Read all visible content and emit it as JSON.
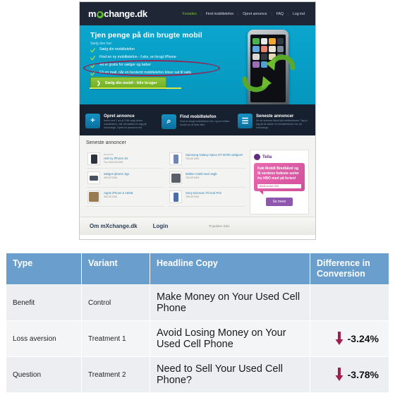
{
  "screenshot": {
    "site": {
      "logo_prefix": "m",
      "logo_suffix": "change.dk",
      "nav": [
        {
          "label": "Forsiden",
          "active": true
        },
        {
          "label": "Find mobiltelefon",
          "active": false
        },
        {
          "label": "Opret annonce",
          "active": false
        },
        {
          "label": "FAQ",
          "active": false
        },
        {
          "label": "Log ind",
          "active": false
        }
      ],
      "hero": {
        "title": "Tjen penge på din brugte mobil",
        "subtitle": "Sælg den her:",
        "bullets": [
          "Sælg din mobiltelefon",
          "Find en ny mobiltelefon - f.eks. en brugt iPhone",
          "Alt er gratis for sælger og køber",
          "Få en mail, når en bestemt mobiltelefon bliver sat til salg."
        ],
        "cta_label": "Sælg din mobil - bliv bruger",
        "cta_arrow": "❯"
      },
      "features": [
        {
          "icon": "plus-icon",
          "glyph": "+",
          "title": "Opret annonce",
          "desc": "Intere end 2 ud af 3 får solgt deres mobiltelefon, når det sættes til salg på mXchange. Opret en annonce her."
        },
        {
          "icon": "search-icon",
          "glyph": "⌕",
          "title": "Find mobiltelefon",
          "desc": "Find en brugt mobiltelefon her, og se hvilken model du vil lede efter."
        },
        {
          "icon": "list-icon",
          "glyph": "☰",
          "title": "Seneste annoncer",
          "desc": "Se de seneste tilbud på mobiltelefoner. Tag et kig på de sidste 10 mobiltelefoner her på mXchange."
        }
      ],
      "listings": {
        "heading": "Seneste annoncer",
        "left": [
          {
            "tag": "Annonce",
            "title": "Helt ny iPhone 4S",
            "price": "Fra 1444,00 DKK",
            "color": "#2b3340"
          },
          {
            "tag": "",
            "title": "sælges iphone 3gs",
            "price": "400,00 DKK",
            "color": "#4a5160"
          },
          {
            "tag": "",
            "title": "Apple iPhone 5 16GB",
            "price": "400,00 DKK",
            "color": "#9a7b4f"
          }
        ],
        "right": [
          {
            "tag": "",
            "title": "Samsung Galaxy Spica GT-I5700 sælges!!",
            "price": "700,00 DKK",
            "color": "#6f86b5"
          },
          {
            "tag": "",
            "title": "lækker mobil med 16gb",
            "price": "750,00 DKK",
            "color": "#5a5f68"
          },
          {
            "tag": "",
            "title": "Sony Ericsson Til God Pris",
            "price": "795,00 DKK",
            "color": "#4b6fa8"
          }
        ]
      },
      "promo": {
        "brand": "Telia",
        "text": "Køb Mobilt Bredbånd og få verdens fedeste serier fra HBO med på ferien!",
        "note": "Bestil senest 15/8",
        "button": "Se mere"
      },
      "footer": {
        "links": [
          "Om mXchange.dk",
          "Login"
        ],
        "small": "Populære links"
      }
    }
  },
  "table": {
    "headers": [
      "Type",
      "Variant",
      "Headline Copy",
      "Difference in Conversion"
    ],
    "rows": [
      {
        "type": "Benefit",
        "variant": "Control",
        "headline": "Make Money on Your Used Cell Phone",
        "difference": "",
        "has_arrow": false
      },
      {
        "type": "Loss aversion",
        "variant": "Treatment 1",
        "headline": "Avoid Losing Money on Your Used Cell Phone",
        "difference": "-3.24%",
        "has_arrow": true
      },
      {
        "type": "Question",
        "variant": "Treatment 2",
        "headline": "Need to Sell Your Used Cell Phone?",
        "difference": "-3.78%",
        "has_arrow": true
      }
    ]
  },
  "colors": {
    "header_bg": "#1f2736",
    "hero_bg": "#0aa6ce",
    "accent_green": "#7cc92c",
    "table_header": "#6a9fcd",
    "arrow_red": "#a01d4c",
    "annotation_red": "#9e1b4d"
  }
}
